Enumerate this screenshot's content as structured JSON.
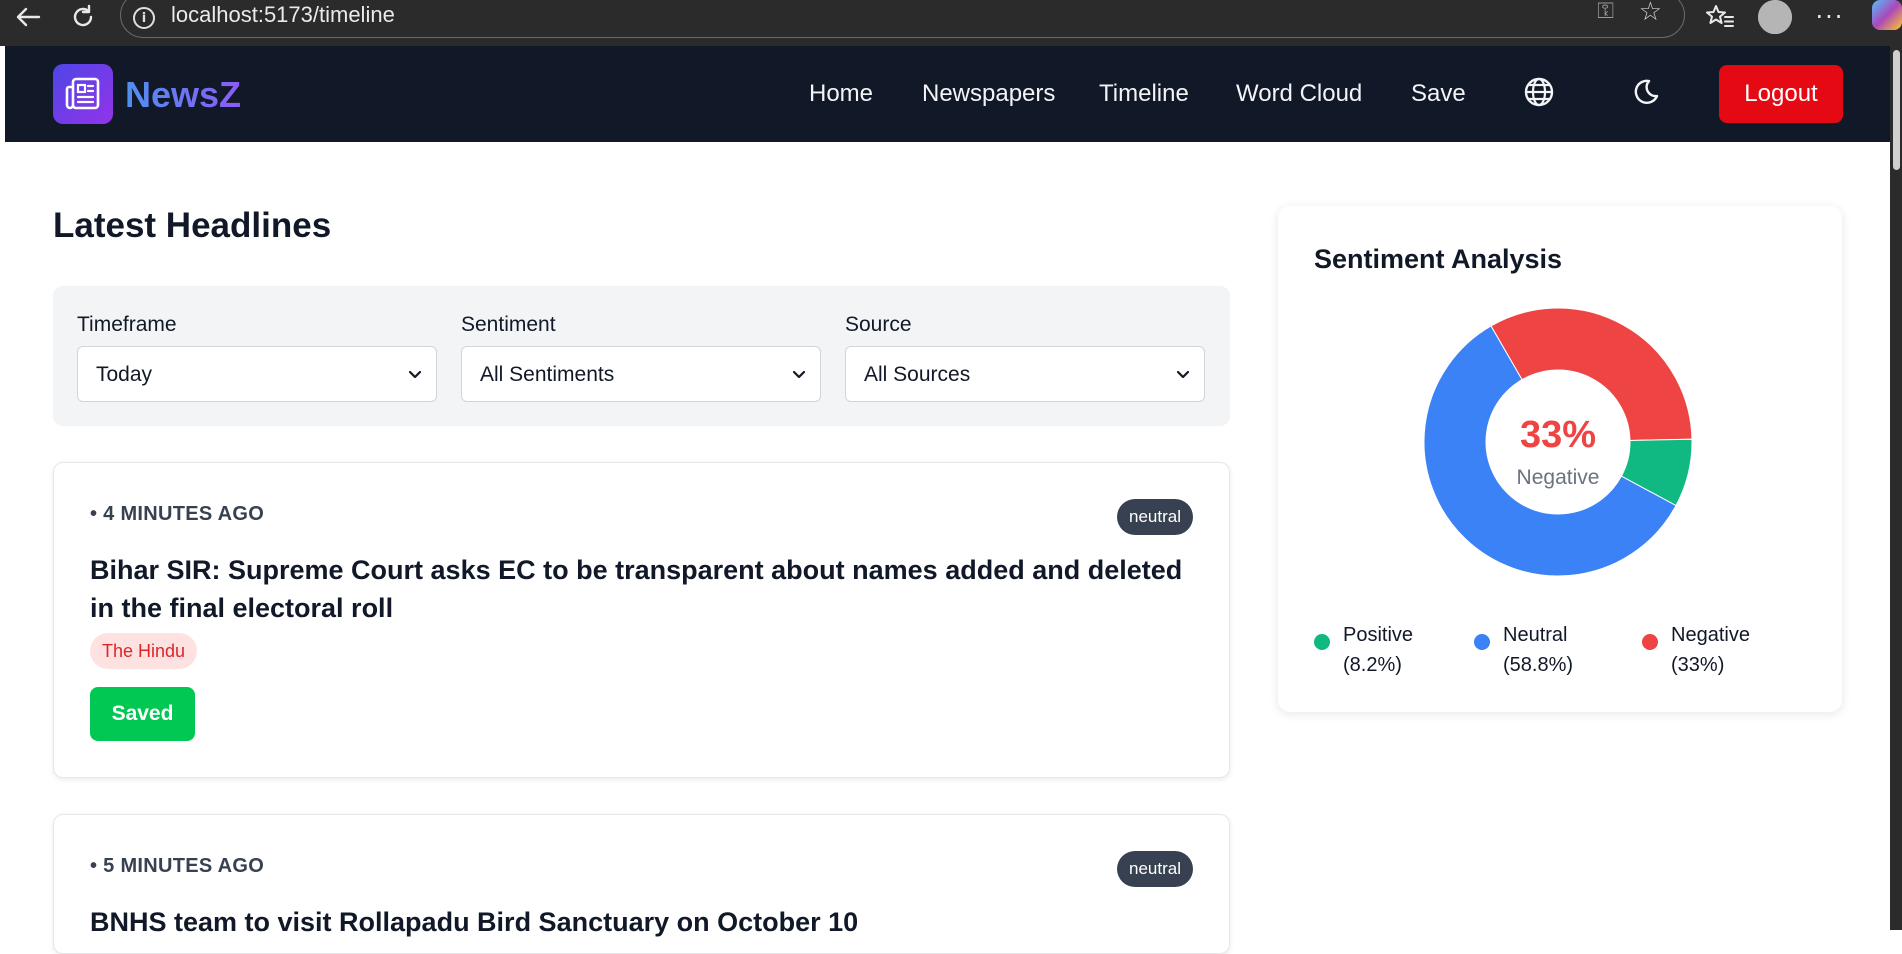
{
  "browser": {
    "url": "localhost:5173/timeline"
  },
  "nav": {
    "brand": "NewsZ",
    "links": [
      "Home",
      "Newspapers",
      "Timeline",
      "Word Cloud",
      "Save"
    ],
    "logout_label": "Logout"
  },
  "page": {
    "title": "Latest Headlines"
  },
  "filters": [
    {
      "label": "Timeframe",
      "value": "Today"
    },
    {
      "label": "Sentiment",
      "value": "All Sentiments"
    },
    {
      "label": "Source",
      "value": "All Sources"
    }
  ],
  "articles": [
    {
      "time": "• 4 MINUTES AGO",
      "sentiment": "neutral",
      "title": "Bihar SIR: Supreme Court asks EC to be transparent about names added and deleted in the final electoral roll",
      "source": "The Hindu",
      "action": "Saved"
    },
    {
      "time": "• 5 MINUTES AGO",
      "sentiment": "neutral",
      "title": "BNHS team to visit Rollapadu Bird Sanctuary on October 10"
    }
  ],
  "sentiment_panel": {
    "title": "Sentiment Analysis",
    "center_value": "33%",
    "center_label": "Negative",
    "legend": [
      {
        "name": "Positive",
        "pct": "(8.2%)",
        "color": "#10b981"
      },
      {
        "name": "Neutral",
        "pct": "(58.8%)",
        "color": "#3b82f6"
      },
      {
        "name": "Negative",
        "pct": "(33%)",
        "color": "#ef4444"
      }
    ]
  },
  "chart_data": {
    "type": "pie",
    "categories": [
      "Positive",
      "Neutral",
      "Negative"
    ],
    "values": [
      8.2,
      58.8,
      33
    ],
    "colors": [
      "#10b981",
      "#3b82f6",
      "#ef4444"
    ],
    "title": "Sentiment Analysis",
    "legend": "bottom",
    "donut": true
  }
}
